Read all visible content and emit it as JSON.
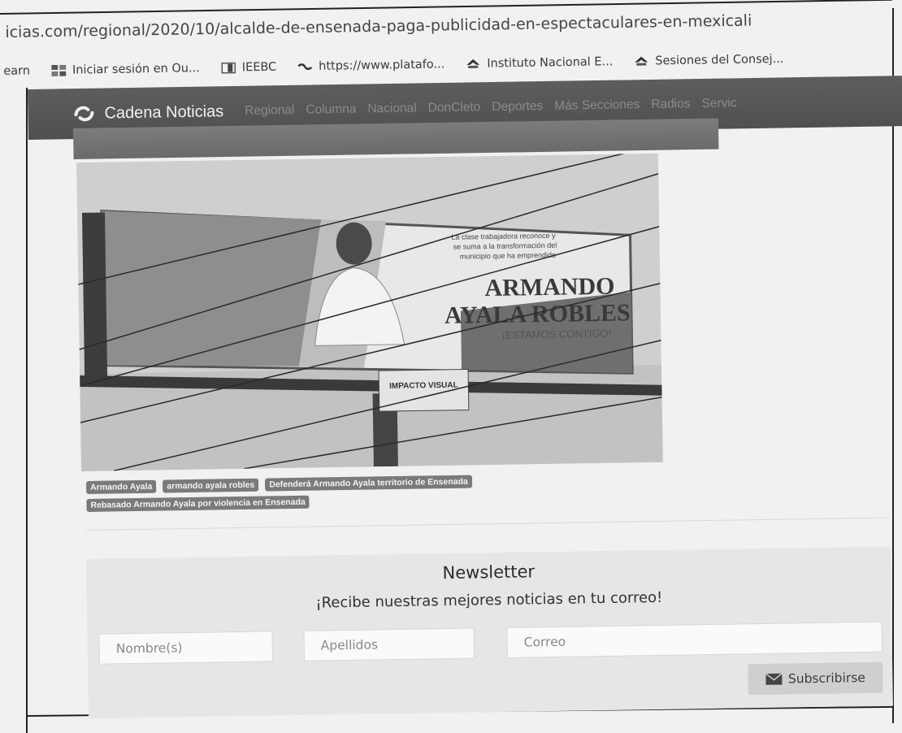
{
  "browser": {
    "url": "icias.com/regional/2020/10/alcalde-de-ensenada-paga-publicidad-en-espectaculares-en-mexicali",
    "bookmarks": [
      {
        "label": "earn",
        "icon": "none"
      },
      {
        "label": "Iniciar sesión en Ou...",
        "icon": "microsoft-icon"
      },
      {
        "label": "IEEBC",
        "icon": "ieebc-icon"
      },
      {
        "label": "https://www.platafo...",
        "icon": "wave-icon"
      },
      {
        "label": "Instituto Nacional E...",
        "icon": "ine-icon"
      },
      {
        "label": "Sesiones del Consej...",
        "icon": "ine-icon"
      }
    ]
  },
  "site": {
    "brand": "Cadena Noticias",
    "nav": [
      "Regional",
      "Columna",
      "Nacional",
      "DonCleto",
      "Deportes",
      "Más Secciones",
      "Radios",
      "Servic"
    ]
  },
  "article": {
    "billboard_text": {
      "top_line_1": "La clase trabajadora reconoce y",
      "top_line_2": "se suma a la transformación del",
      "top_line_3": "municipio que ha emprendido",
      "name_1": "ARMANDO",
      "name_2": "AYALA ROBLES",
      "tagline": "¡ESTAMOS CONTIGO!",
      "sign": "IMPACTO VISUAL"
    },
    "tags_row1": [
      "Armando Ayala",
      "armando ayala robles",
      "Defenderá Armando Ayala territorio de Ensenada"
    ],
    "tags_row2": [
      "Rebasado Armando Ayala por violencia en Ensenada"
    ]
  },
  "newsletter": {
    "title": "Newsletter",
    "subtitle": "¡Recibe nuestras mejores noticias en tu correo!",
    "name_placeholder": "Nombre(s)",
    "surname_placeholder": "Apellidos",
    "email_placeholder": "Correo",
    "button_label": "Subscribirse"
  }
}
